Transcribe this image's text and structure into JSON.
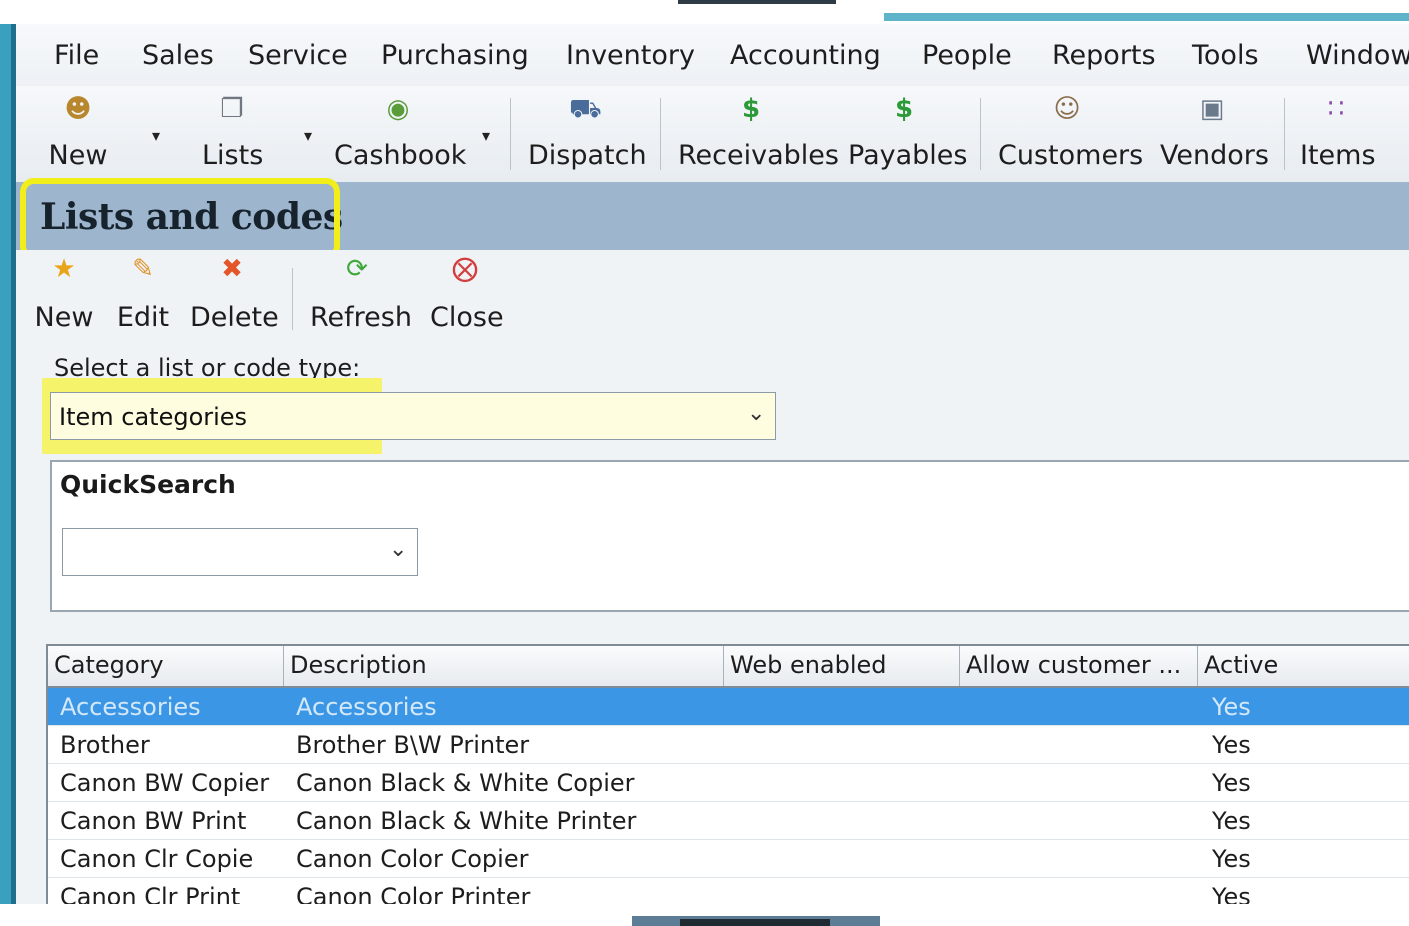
{
  "menu": [
    "File",
    "Sales",
    "Service",
    "Purchasing",
    "Inventory",
    "Accounting",
    "People",
    "Reports",
    "Tools",
    "Window"
  ],
  "toolbar": {
    "new": "New",
    "lists": "Lists",
    "cashbook": "Cashbook",
    "dispatch": "Dispatch",
    "receivables": "Receivables",
    "payables": "Payables",
    "customers": "Customers",
    "vendors": "Vendors",
    "items": "Items"
  },
  "page": {
    "title": "Lists and codes"
  },
  "actions": {
    "new": "New",
    "edit": "Edit",
    "delete": "Delete",
    "refresh": "Refresh",
    "close": "Close"
  },
  "list_select": {
    "label": "Select a list or code type:",
    "value": "Item categories"
  },
  "quicksearch": {
    "title": "QuickSearch",
    "value": ""
  },
  "grid": {
    "columns": [
      "Category",
      "Description",
      "Web enabled",
      "Allow customer ...",
      "Active"
    ],
    "rows": [
      {
        "category": "Accessories",
        "description": "Accessories",
        "web": "",
        "allow": "",
        "active": "Yes",
        "selected": true
      },
      {
        "category": "Brother",
        "description": "Brother B\\W Printer",
        "web": "",
        "allow": "",
        "active": "Yes"
      },
      {
        "category": "Canon BW Copier",
        "description": "Canon Black & White Copier",
        "web": "",
        "allow": "",
        "active": "Yes"
      },
      {
        "category": "Canon BW Print",
        "description": "Canon Black & White Printer",
        "web": "",
        "allow": "",
        "active": "Yes"
      },
      {
        "category": "Canon Clr Copie",
        "description": "Canon Color Copier",
        "web": "",
        "allow": "",
        "active": "Yes"
      },
      {
        "category": "Canon Clr Print",
        "description": "Canon Color Printer",
        "web": "",
        "allow": "",
        "active": "Yes"
      }
    ]
  },
  "colors": {
    "header": "#9eb5ce",
    "highlight": "#f2ee1a",
    "selected_row": "#3b97e6",
    "frame": "#3aa0bf"
  },
  "icons": {
    "new": "person-new-icon",
    "lists": "document-icon",
    "cashbook": "cash-icon",
    "dispatch": "truck-icon",
    "receivables": "dollar-in-icon",
    "payables": "dollar-out-icon",
    "customers": "people-icon",
    "vendors": "vendor-icon",
    "items": "items-icon",
    "star": "star-icon",
    "pencil": "pencil-icon",
    "delete": "x-icon",
    "refresh": "refresh-icon",
    "close": "close-circle-icon"
  }
}
